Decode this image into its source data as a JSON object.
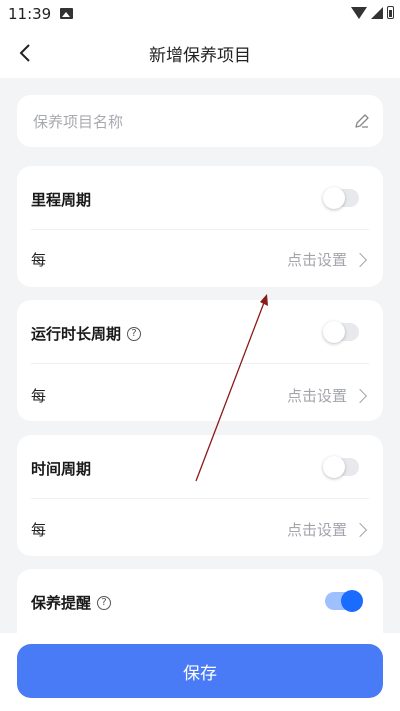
{
  "status": {
    "time": "11:39",
    "icons": [
      "image-icon",
      "wifi-icon",
      "signal-icon",
      "battery-icon"
    ]
  },
  "header": {
    "title": "新增保养项目",
    "back_icon": "chevron-left-icon"
  },
  "name_field": {
    "placeholder": "保养项目名称",
    "value": "",
    "icon": "pencil-icon"
  },
  "cycles": [
    {
      "title": "里程周期",
      "has_help": false,
      "enabled": false,
      "every_label": "每",
      "action_label": "点击设置"
    },
    {
      "title": "运行时长周期",
      "has_help": true,
      "enabled": false,
      "every_label": "每",
      "action_label": "点击设置"
    },
    {
      "title": "时间周期",
      "has_help": false,
      "enabled": false,
      "every_label": "每",
      "action_label": "点击设置"
    }
  ],
  "reminder": {
    "title": "保养提醒",
    "has_help": true,
    "enabled": true
  },
  "help_glyph": "?",
  "footer": {
    "save_label": "保存"
  },
  "colors": {
    "accent": "#1a6cff",
    "save_button": "#4a7bf7",
    "annotation_arrow": "#8b1a1a",
    "background": "#f3f4f6"
  }
}
